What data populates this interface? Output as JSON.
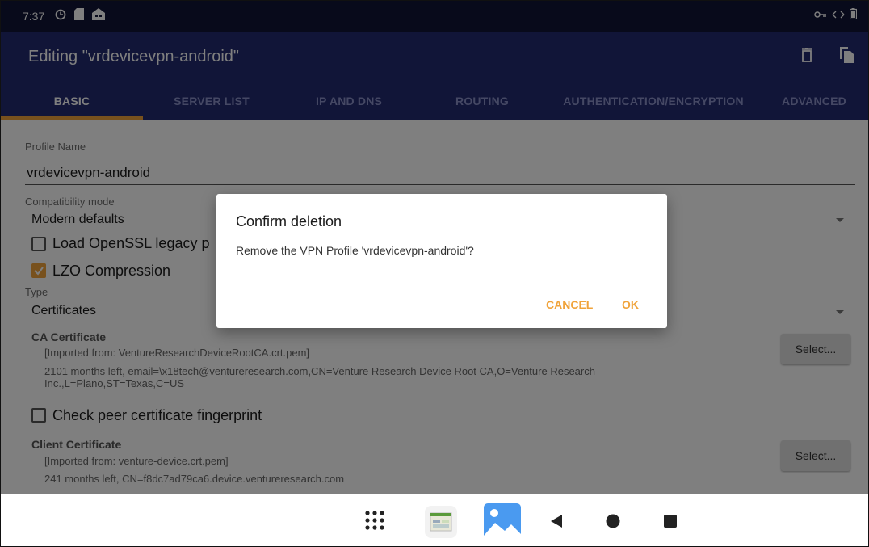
{
  "status_bar": {
    "time": "7:37",
    "left_icons": [
      "sync-icon",
      "sd-card-icon",
      "home-icon"
    ],
    "right_icons": [
      "vpn-key-icon",
      "data-arrows-icon",
      "battery-icon"
    ]
  },
  "app_bar": {
    "title": "Editing \"vrdevicevpn-android\"",
    "actions": [
      "delete-icon",
      "copy-icon"
    ],
    "background": "#232b70"
  },
  "tabs": [
    {
      "label": "BASIC",
      "active": true
    },
    {
      "label": "SERVER LIST",
      "active": false
    },
    {
      "label": "IP AND DNS",
      "active": false
    },
    {
      "label": "ROUTING",
      "active": false
    },
    {
      "label": "AUTHENTICATION/ENCRYPTION",
      "active": false
    },
    {
      "label": "ADVANCED",
      "active": false
    }
  ],
  "form": {
    "profile_name_label": "Profile Name",
    "profile_name_value": "vrdevicevpn-android",
    "compat_label": "Compatibility mode",
    "compat_value": "Modern defaults",
    "load_openssl_label": "Load OpenSSL legacy p",
    "load_openssl_checked": false,
    "lzo_label": "LZO Compression",
    "lzo_checked": true,
    "type_label": "Type",
    "type_value": "Certificates",
    "ca_cert_label": "CA Certificate",
    "ca_cert_line1": "[Imported from: VentureResearchDeviceRootCA.crt.pem]",
    "ca_cert_line2": "2101 months left, email=\\x18tech@ventureresearch.com,CN=Venture Research Device Root CA,O=Venture Research",
    "ca_cert_line3": "Inc.,L=Plano,ST=Texas,C=US",
    "ca_select_label": "Select...",
    "peer_fp_label": "Check peer certificate fingerprint",
    "peer_fp_checked": false,
    "client_cert_label": "Client Certificate",
    "client_cert_line1": "[Imported from: venture-device.crt.pem]",
    "client_cert_line2": "241 months left, CN=f8dc7ad79ca6.device.ventureresearch.com",
    "client_select_label": "Select..."
  },
  "dialog": {
    "title": "Confirm deletion",
    "message": "Remove the VPN Profile 'vrdevicevpn-android'?",
    "cancel_label": "CANCEL",
    "ok_label": "OK",
    "accent": "#f0a33a"
  },
  "nav_bar": {
    "items": [
      "app-drawer-icon",
      "recent-app-icon",
      "gallery-icon",
      "back-icon",
      "home-icon",
      "overview-icon"
    ]
  }
}
